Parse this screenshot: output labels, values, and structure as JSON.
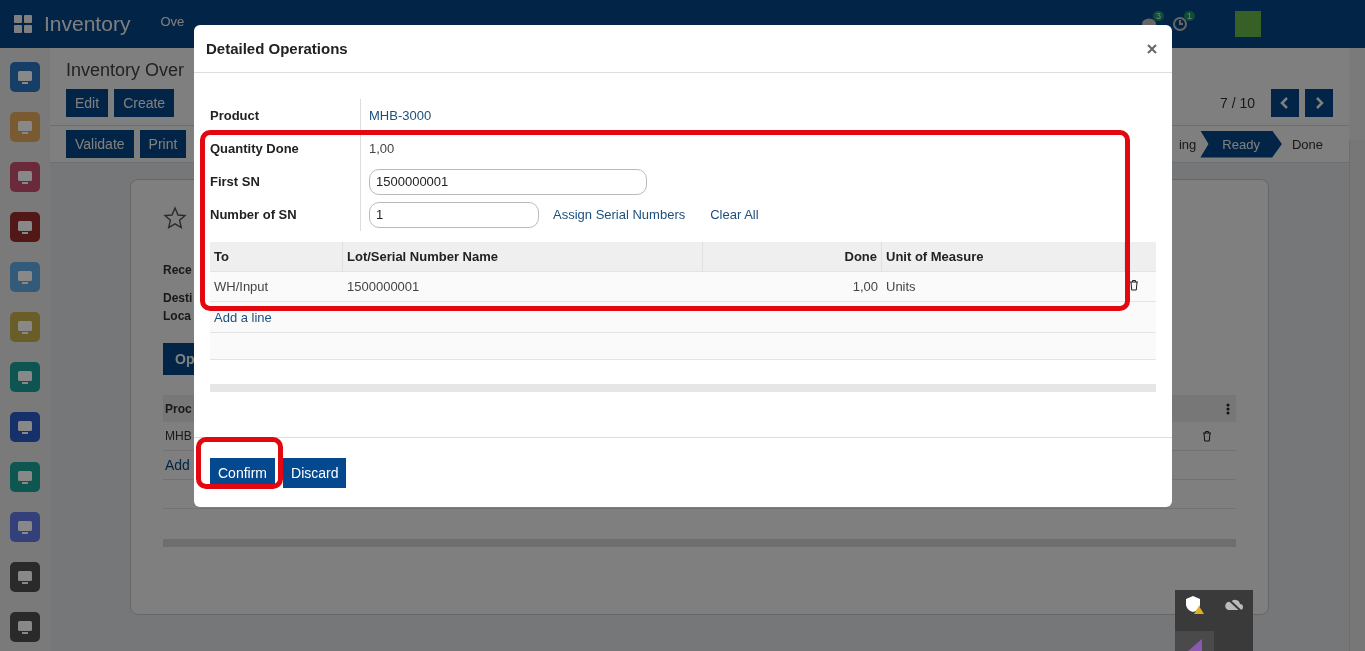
{
  "navbar": {
    "app_name": "Inventory",
    "menu": [
      "Ove"
    ],
    "messages_badge": "3",
    "activities_badge": "1"
  },
  "sidebar": {
    "apps": [
      {
        "color": "#163e66"
      },
      {
        "color": "#7a5a30"
      },
      {
        "color": "#6a2a3c"
      },
      {
        "color": "#521818"
      },
      {
        "color": "#345a7a"
      },
      {
        "color": "#6a5e28"
      },
      {
        "color": "#0e5450"
      },
      {
        "color": "#16306a"
      },
      {
        "color": "#0e5650"
      },
      {
        "color": "#34407a"
      },
      {
        "color": "#2a2a2a"
      },
      {
        "color": "#2a2a2a"
      }
    ]
  },
  "breadcrumb": "Inventory Over",
  "actions": [
    "Edit",
    "Create"
  ],
  "pager": "7 / 10",
  "header_buttons": [
    "Validate",
    "Print"
  ],
  "statuses": [
    {
      "label": "ing",
      "selected": false
    },
    {
      "label": "Ready",
      "selected": true
    },
    {
      "label": "Done",
      "selected": false
    }
  ],
  "form": {
    "labels": [
      "Rece",
      "Desti",
      "Loca"
    ],
    "tab": "Op",
    "table": {
      "columns": [
        "Proc"
      ],
      "rows": [
        [
          "MHB"
        ]
      ],
      "add_line": "Add"
    }
  },
  "dialog": {
    "title": "Detailed Operations",
    "fields": [
      {
        "label": "Product",
        "kind": "link",
        "value": "MHB-3000"
      },
      {
        "label": "Quantity Done",
        "kind": "text",
        "value": "1,00"
      },
      {
        "label": "First SN",
        "kind": "input",
        "value": "1500000001"
      },
      {
        "label": "Number of SN",
        "kind": "input",
        "value": "1"
      }
    ],
    "links": [
      "Assign Serial Numbers",
      "Clear All"
    ],
    "table": {
      "columns": [
        "To",
        "Lot/Serial Number Name",
        "Done",
        "Unit of Measure"
      ],
      "rows": [
        [
          "WH/Input",
          "1500000001",
          "1,00",
          "Units"
        ]
      ],
      "add_line": "Add a line"
    },
    "buttons": [
      "Confirm",
      "Discard"
    ]
  }
}
